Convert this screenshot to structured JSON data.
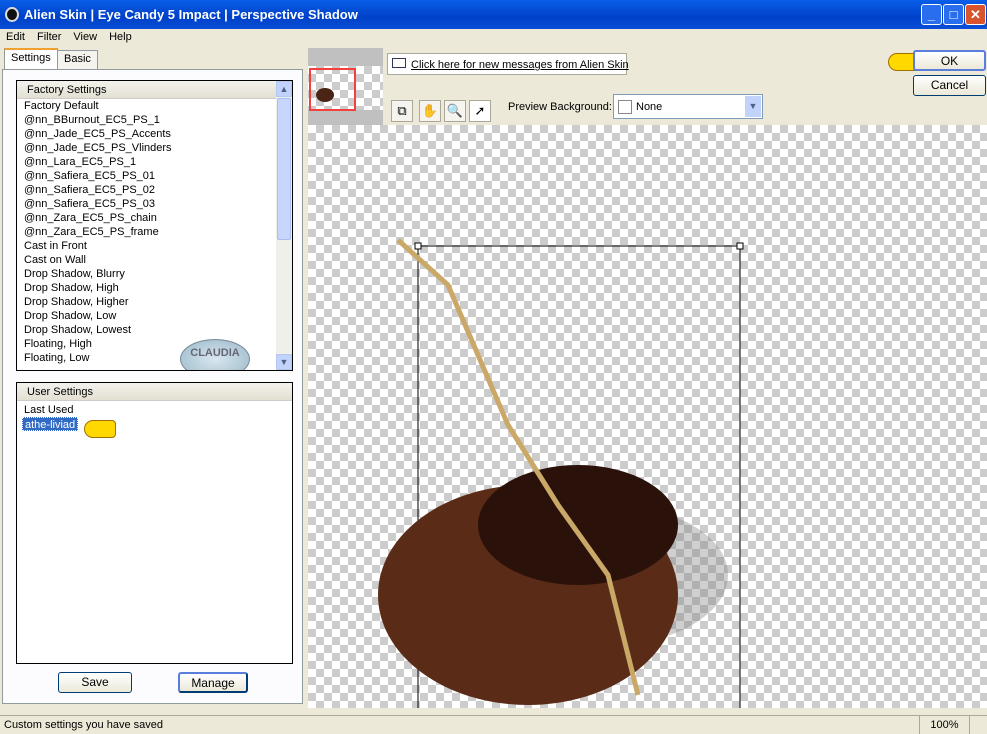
{
  "window": {
    "title": "Alien Skin | Eye Candy 5 Impact | Perspective Shadow"
  },
  "menu": [
    "Edit",
    "Filter",
    "View",
    "Help"
  ],
  "tabs": [
    "Settings",
    "Basic"
  ],
  "factory": {
    "header": "Factory Settings",
    "items": [
      "Factory Default",
      "@nn_BBurnout_EC5_PS_1",
      "@nn_Jade_EC5_PS_Accents",
      "@nn_Jade_EC5_PS_Vlinders",
      "@nn_Lara_EC5_PS_1",
      "@nn_Safiera_EC5_PS_01",
      "@nn_Safiera_EC5_PS_02",
      "@nn_Safiera_EC5_PS_03",
      "@nn_Zara_EC5_PS_chain",
      "@nn_Zara_EC5_PS_frame",
      "Cast in Front",
      "Cast on Wall",
      "Drop Shadow, Blurry",
      "Drop Shadow, High",
      "Drop Shadow, Higher",
      "Drop Shadow, Low",
      "Drop Shadow, Lowest",
      "Floating, High",
      "Floating, Low"
    ]
  },
  "watermark": "CLAUDIA",
  "user": {
    "header": "User Settings",
    "items": [
      "Last Used",
      "athe-liviad"
    ],
    "selected": "athe-liviad"
  },
  "buttons": {
    "save": "Save",
    "manage": "Manage",
    "ok": "OK",
    "cancel": "Cancel"
  },
  "messages_link": "Click here for new messages from Alien Skin",
  "preview_bg": {
    "label": "Preview Background:",
    "value": "None"
  },
  "status": {
    "text": "Custom settings you have saved",
    "zoom": "100%"
  }
}
